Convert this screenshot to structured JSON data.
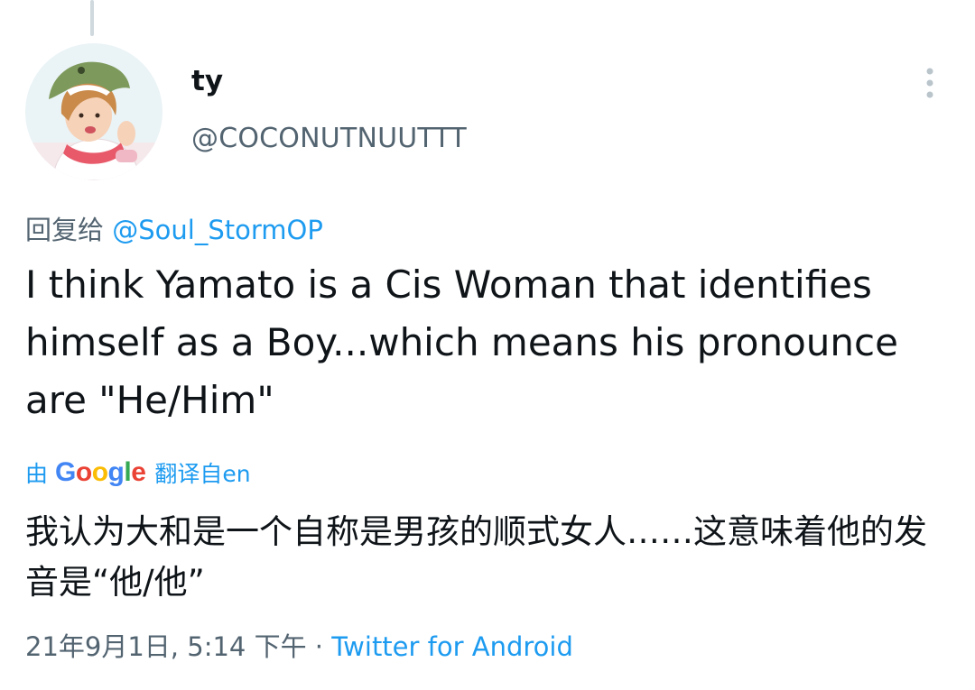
{
  "author": {
    "display_name": "ty",
    "handle": "@COCONUTNUUTTT"
  },
  "reply": {
    "prefix": "回复给",
    "mention": "@Soul_StormOP"
  },
  "tweet": {
    "text": "I think Yamato is a Cis Woman that identifies himself as a Boy...which means his pronounce are \"He/Him\""
  },
  "translation": {
    "by_label": "由",
    "google_letters": [
      "G",
      "o",
      "o",
      "g",
      "l",
      "e"
    ],
    "from_label": "翻译自en",
    "text": "我认为大和是一个自称是男孩的顺式女人……这意味着他的发音是“他/他”"
  },
  "meta": {
    "timestamp": "21年9月1日, 5:14 下午",
    "separator": " · ",
    "source": "Twitter for Android"
  },
  "icons": {
    "more": "more-vertical-icon",
    "avatar": "profile-avatar"
  },
  "colors": {
    "link": "#1d9bf0",
    "secondary_text": "#536471",
    "primary_text": "#0f1419",
    "thread_line": "#cfd9de"
  }
}
